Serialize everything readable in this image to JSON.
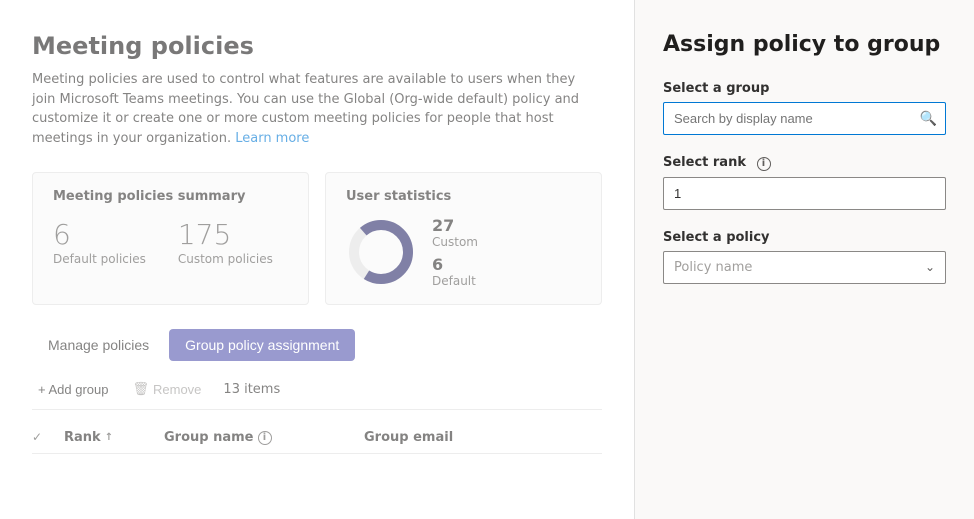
{
  "left": {
    "title": "Meeting policies",
    "description": "Meeting policies are used to control what features are available to users when they join Microsoft Teams meetings. You can use the Global (Org-wide default) policy and customize it or create one or more custom meeting policies for people that host meetings in your organization.",
    "learn_more": "Learn more",
    "summary_card": {
      "title": "Meeting policies summary",
      "default_count": "6",
      "default_label": "Default policies",
      "custom_count": "175",
      "custom_label": "Custom policies"
    },
    "user_stats_card": {
      "title": "User statistics",
      "custom_value": "27",
      "custom_label": "Custom",
      "default_value": "6",
      "default_label": "Default"
    },
    "tabs": [
      {
        "id": "manage",
        "label": "Manage policies",
        "active": false
      },
      {
        "id": "group",
        "label": "Group policy assignment",
        "active": true
      }
    ],
    "toolbar": {
      "add_label": "+ Add group",
      "remove_label": "Remove",
      "items_count": "13 items"
    },
    "table": {
      "col_rank": "Rank",
      "col_group_name": "Group name",
      "col_email": "Group email"
    }
  },
  "right": {
    "title": "Assign policy to group",
    "select_group_label": "Select a group",
    "search_placeholder": "Search by display name",
    "select_rank_label": "Select rank",
    "rank_value": "1",
    "select_policy_label": "Select a policy",
    "policy_placeholder": "Policy name"
  }
}
